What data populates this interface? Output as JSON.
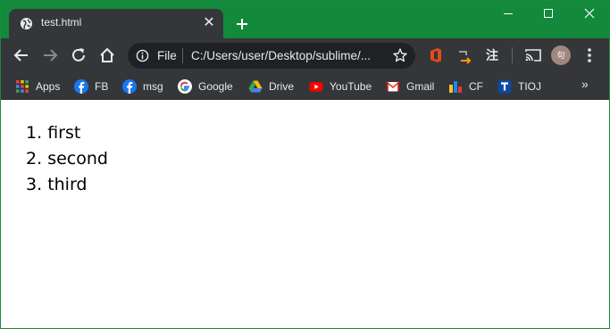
{
  "tab": {
    "title": "test.html",
    "favicon": "globe-icon"
  },
  "window_controls": {
    "minimize": "—",
    "maximize": "☐",
    "close": "✕"
  },
  "omnibox": {
    "scheme": "File",
    "url": "C:/Users/user/Desktop/sublime/..."
  },
  "toolbar": {
    "extension_zhu": "注",
    "avatar_text": "句"
  },
  "bookmarks": [
    {
      "label": "Apps",
      "icon": "apps-grid-icon"
    },
    {
      "label": "FB",
      "icon": "facebook-icon"
    },
    {
      "label": "msg",
      "icon": "facebook-icon"
    },
    {
      "label": "Google",
      "icon": "google-icon"
    },
    {
      "label": "Drive",
      "icon": "drive-icon"
    },
    {
      "label": "YouTube",
      "icon": "youtube-icon"
    },
    {
      "label": "Gmail",
      "icon": "gmail-icon"
    },
    {
      "label": "CF",
      "icon": "codeforces-icon"
    },
    {
      "label": "TIOJ",
      "icon": "tioj-icon"
    }
  ],
  "bookmarks_overflow": "»",
  "page": {
    "list_items": [
      {
        "number": "1.",
        "text": "first"
      },
      {
        "number": "2.",
        "text": "second"
      },
      {
        "number": "3.",
        "text": "third"
      }
    ]
  },
  "colors": {
    "titlebar": "#12893b",
    "toolbar": "#35363a",
    "omnibox": "#202124"
  }
}
